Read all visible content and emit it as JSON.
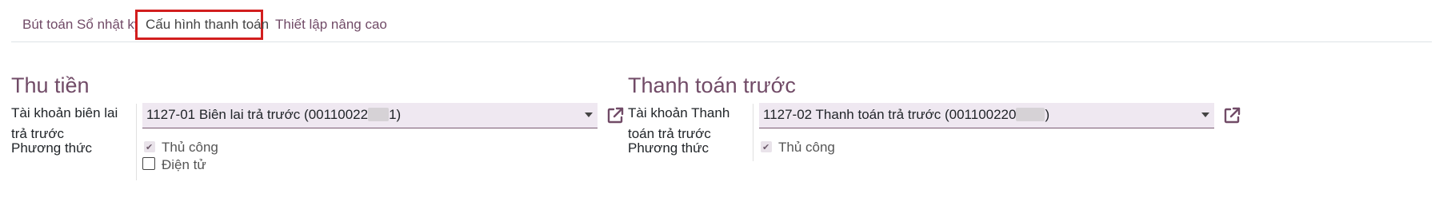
{
  "tabs": [
    {
      "label": "Bút toán Sổ nhật ký"
    },
    {
      "label": "Cấu hình thanh toán"
    },
    {
      "label": "Thiết lập nâng cao"
    }
  ],
  "active_tab": "Cấu hình thanh toán",
  "receive": {
    "title": "Thu tiền",
    "account_label": "Tài khoản biên lai trả trước",
    "account_label_line1": "Tài khoản biên lai",
    "account_label_line2": "trả trước",
    "account_value_prefix": "1127-01 Biên lai trả trước (00110022",
    "account_value_suffix": "1)",
    "method_label": "Phương thức",
    "methods": [
      {
        "label": "Thủ công",
        "checked": true
      },
      {
        "label": "Điện tử",
        "checked": false
      }
    ]
  },
  "pay": {
    "title": "Thanh toán trước",
    "account_label": "Tài khoản Thanh toán trả trước",
    "account_label_line1": "Tài khoản Thanh",
    "account_label_line2": "toán trả trước",
    "account_value_prefix": "1127-02 Thanh toán trả trước (001100220",
    "account_value_suffix": ")",
    "method_label": "Phương thức",
    "methods": [
      {
        "label": "Thủ công",
        "checked": true
      }
    ]
  },
  "colors": {
    "accent": "#714b67",
    "highlight_border": "#d21e1e",
    "field_bg": "#efe8f1"
  },
  "icons": {
    "external_link": "external-link-icon",
    "dropdown": "caret-down-icon"
  }
}
